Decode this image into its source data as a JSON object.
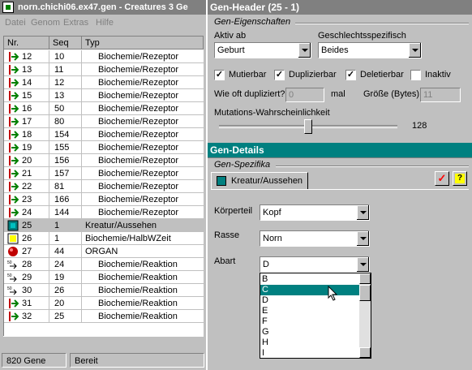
{
  "left": {
    "title": "norn.chichi06.ex47.gen - Creatures 3 Ge",
    "menu": [
      "Datei",
      "Genom",
      "Extras",
      "Hilfe"
    ],
    "columns": [
      "Nr.",
      "Seq",
      "Typ"
    ],
    "rows": [
      {
        "nr": "12",
        "seq": "10",
        "typ": "Biochemie/Rezeptor",
        "icon": "receptor-icon"
      },
      {
        "nr": "13",
        "seq": "11",
        "typ": "Biochemie/Rezeptor",
        "icon": "receptor-icon"
      },
      {
        "nr": "14",
        "seq": "12",
        "typ": "Biochemie/Rezeptor",
        "icon": "receptor-icon"
      },
      {
        "nr": "15",
        "seq": "13",
        "typ": "Biochemie/Rezeptor",
        "icon": "receptor-icon"
      },
      {
        "nr": "16",
        "seq": "50",
        "typ": "Biochemie/Rezeptor",
        "icon": "receptor-icon"
      },
      {
        "nr": "17",
        "seq": "80",
        "typ": "Biochemie/Rezeptor",
        "icon": "receptor-icon"
      },
      {
        "nr": "18",
        "seq": "154",
        "typ": "Biochemie/Rezeptor",
        "icon": "receptor-icon"
      },
      {
        "nr": "19",
        "seq": "155",
        "typ": "Biochemie/Rezeptor",
        "icon": "receptor-icon"
      },
      {
        "nr": "20",
        "seq": "156",
        "typ": "Biochemie/Rezeptor",
        "icon": "receptor-icon"
      },
      {
        "nr": "21",
        "seq": "157",
        "typ": "Biochemie/Rezeptor",
        "icon": "receptor-icon"
      },
      {
        "nr": "22",
        "seq": "81",
        "typ": "Biochemie/Rezeptor",
        "icon": "receptor-icon"
      },
      {
        "nr": "23",
        "seq": "166",
        "typ": "Biochemie/Rezeptor",
        "icon": "receptor-icon"
      },
      {
        "nr": "24",
        "seq": "144",
        "typ": "Biochemie/Rezeptor",
        "icon": "receptor-icon"
      },
      {
        "nr": "25",
        "seq": "1",
        "typ": "Kreatur/Aussehen",
        "icon": "creature-appearance-icon",
        "selected": true
      },
      {
        "nr": "26",
        "seq": "1",
        "typ": "Biochemie/HalbWZeit",
        "icon": "half-life-icon"
      },
      {
        "nr": "27",
        "seq": "44",
        "typ": "ORGAN",
        "icon": "organ-icon"
      },
      {
        "nr": "28",
        "seq": "24",
        "typ": "Biochemie/Reaktion",
        "icon": "reaction-icon"
      },
      {
        "nr": "29",
        "seq": "19",
        "typ": "Biochemie/Reaktion",
        "icon": "reaction-icon"
      },
      {
        "nr": "30",
        "seq": "26",
        "typ": "Biochemie/Reaktion",
        "icon": "reaction-icon"
      },
      {
        "nr": "31",
        "seq": "20",
        "typ": "Biochemie/Reaktion",
        "icon": "receptor-icon"
      },
      {
        "nr": "32",
        "seq": "25",
        "typ": "Biochemie/Reaktion",
        "icon": "receptor-icon"
      }
    ],
    "status": {
      "count": "820 Gene",
      "state": "Bereit"
    }
  },
  "header": {
    "title": "Gen-Header (25 - 1)",
    "group_label": "Gen-Eigenschaften",
    "aktiv_label": "Aktiv ab",
    "aktiv_value": "Geburt",
    "geschlecht_label": "Geschlechtsspezifisch",
    "geschlecht_value": "Beides",
    "checks": [
      {
        "label": "Mutierbar",
        "checked": true
      },
      {
        "label": "Duplizierbar",
        "checked": true
      },
      {
        "label": "Deletierbar",
        "checked": true
      },
      {
        "label": "Inaktiv",
        "checked": false
      }
    ],
    "dup_label": "Wie oft dupliziert?",
    "dup_value": "0",
    "dup_unit": "mal",
    "size_label": "Größe (Bytes)",
    "size_value": "11",
    "mut_label": "Mutations-Wahrscheinlichkeit",
    "mut_value": "128",
    "mut_max": 255
  },
  "details": {
    "title": "Gen-Details",
    "group_label": "Gen-Spezifika",
    "tab_label": "Kreatur/Aussehen",
    "koerperteil_label": "Körperteil",
    "koerperteil_value": "Kopf",
    "rasse_label": "Rasse",
    "rasse_value": "Norn",
    "abart_label": "Abart",
    "abart_value": "D",
    "abart_options": [
      "B",
      "C",
      "D",
      "E",
      "F",
      "G",
      "H",
      "I"
    ],
    "abart_highlight": "C"
  },
  "colors": {
    "header_title_bg": "#808080",
    "details_title_bg": "#008080",
    "highlight": "#008080",
    "check_red": "#ff0000",
    "help_yellow": "#ffff00"
  }
}
